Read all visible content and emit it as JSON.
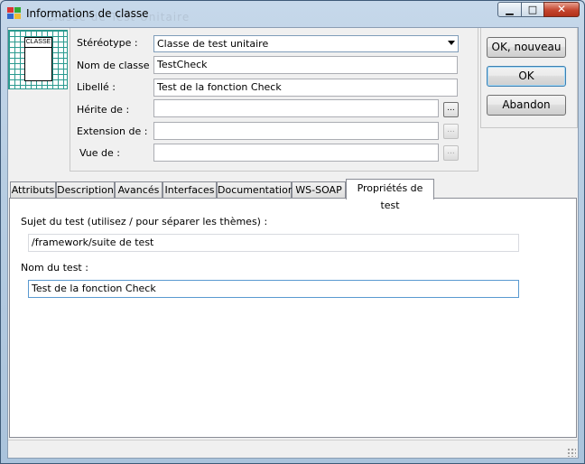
{
  "window": {
    "title": "Informations de classe",
    "ghost_title": "Classe de Test Unitaire"
  },
  "icon": {
    "class_label": "CLASSE"
  },
  "form": {
    "stereotype_label": "Stéréotype :",
    "stereotype_value": "Classe de test unitaire",
    "classname_label": "Nom de classe :",
    "classname_value": "TestCheck",
    "libelle_label": "Libellé :",
    "libelle_value": "Test de la fonction Check",
    "herite_label": "Hérite de :",
    "herite_value": "",
    "extension_label": "Extension de :",
    "extension_value": "",
    "vue_label": "Vue de :",
    "vue_value": "",
    "dots": "..."
  },
  "buttons": {
    "ok_new": "OK, nouveau",
    "ok": "OK",
    "cancel": "Abandon"
  },
  "tabs": [
    {
      "label": "Attributs"
    },
    {
      "label": "Description"
    },
    {
      "label": "Avancés"
    },
    {
      "label": "Interfaces"
    },
    {
      "label": "Documentation"
    },
    {
      "label": "WS-SOAP"
    },
    {
      "label": "Propriétés de test"
    }
  ],
  "test_props": {
    "subject_label": "Sujet du test (utilisez / pour séparer les thèmes) :",
    "subject_value": "/framework/suite de test",
    "name_label": "Nom du test :",
    "name_value": "Test de la fonction Check"
  }
}
